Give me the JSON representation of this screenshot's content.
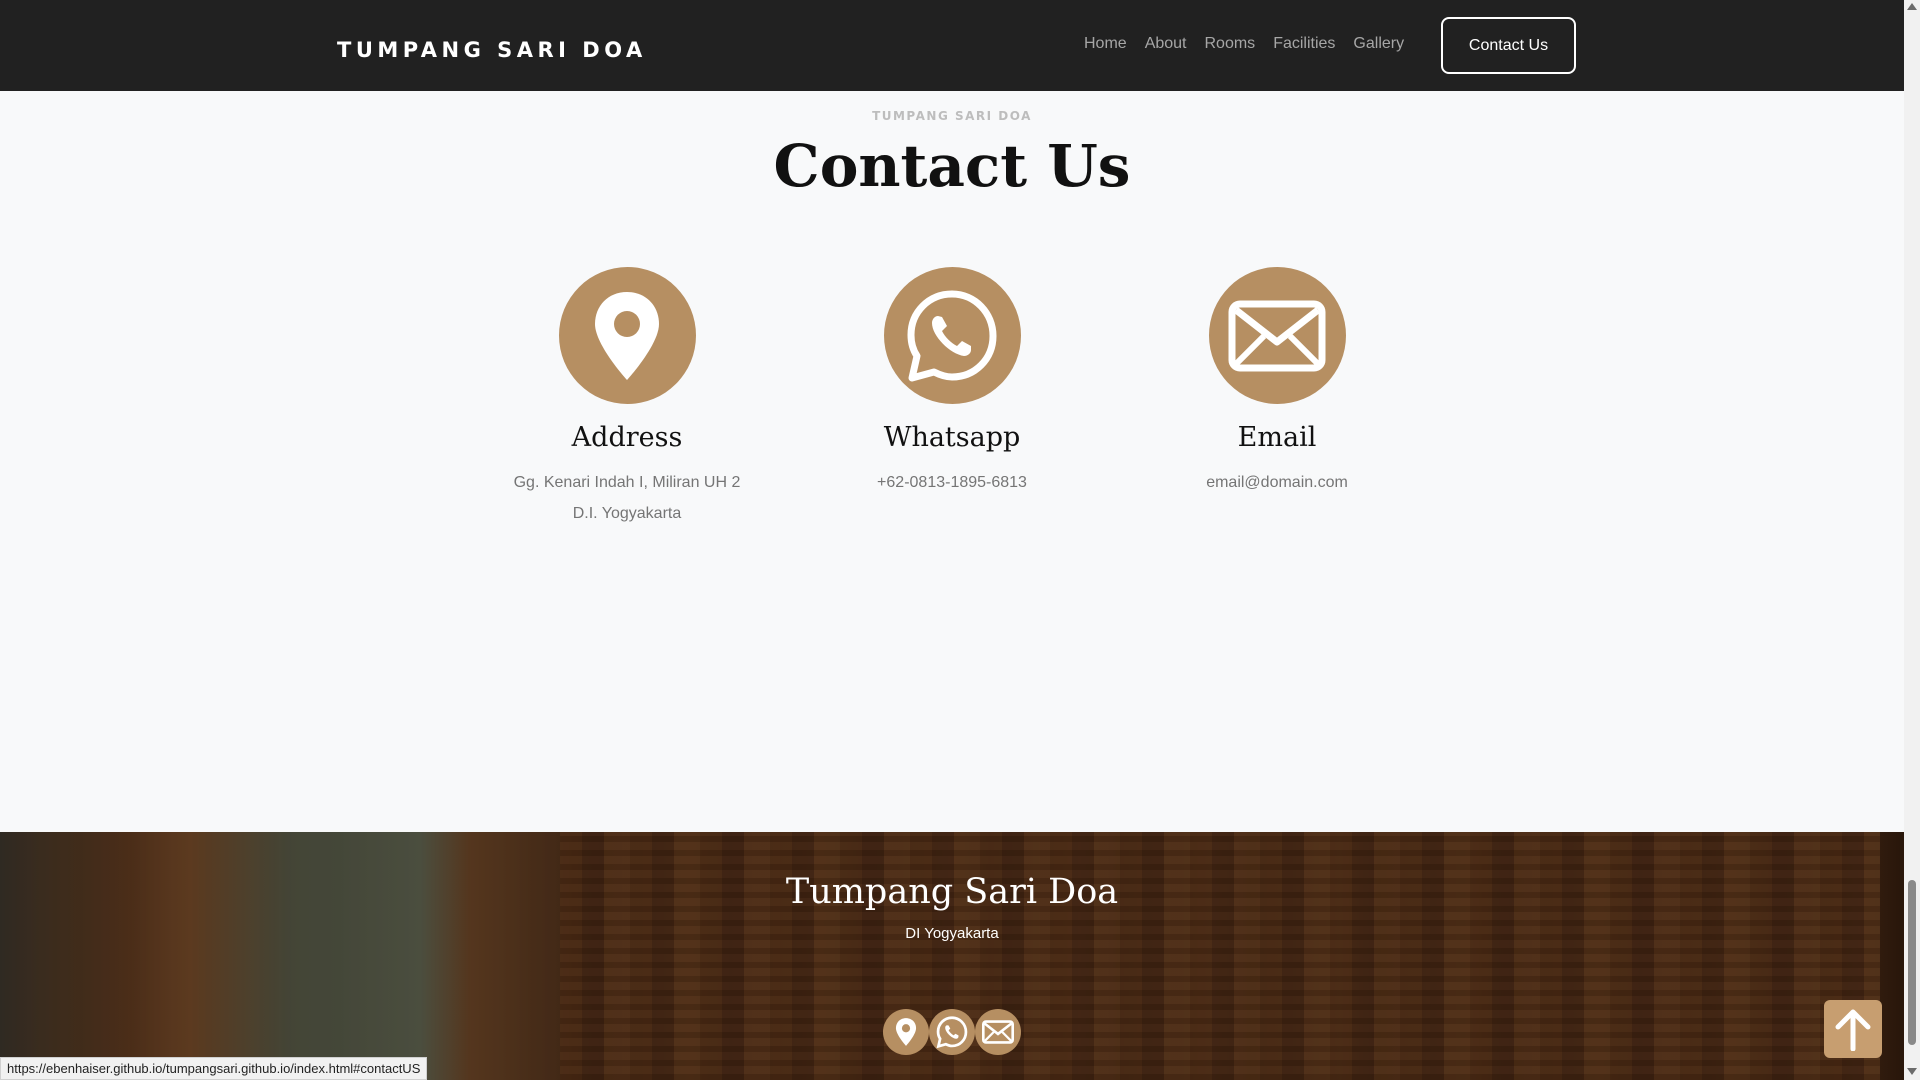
{
  "navbar": {
    "brand": "TUMPANG SARI DOA",
    "links": [
      "Home",
      "About",
      "Rooms",
      "Facilities",
      "Gallery"
    ],
    "cta": "Contact Us"
  },
  "contact": {
    "eyebrow": "TUMPANG SARI DOA",
    "title": "Contact Us",
    "cards": [
      {
        "icon": "location-pin-icon",
        "title": "Address",
        "lines": [
          "Gg. Kenari Indah I, Miliran UH 2",
          "D.I. Yogyakarta"
        ]
      },
      {
        "icon": "whatsapp-icon",
        "title": "Whatsapp",
        "lines": [
          "+62-0813-1895-6813"
        ]
      },
      {
        "icon": "envelope-icon",
        "title": "Email",
        "lines": [
          "email@domain.com"
        ]
      }
    ]
  },
  "footer": {
    "title": "Tumpang Sari Doa",
    "subtitle": "DI Yogyakarta",
    "icons": [
      "location-pin-icon",
      "whatsapp-icon",
      "envelope-icon"
    ]
  },
  "status_bar": {
    "url": "https://ebenhaiser.github.io/tumpangsari.github.io/index.html#contactUS"
  },
  "colors": {
    "accent": "#b68f62",
    "navbar": "#212121",
    "page_bg": "#f8f9fa"
  }
}
